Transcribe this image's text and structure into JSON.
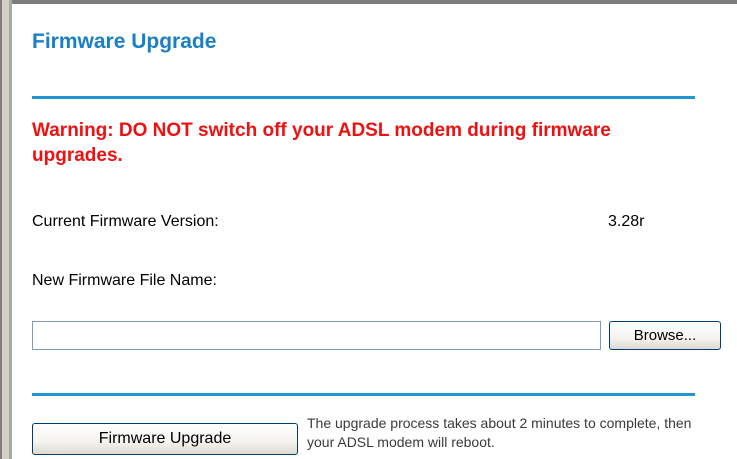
{
  "page": {
    "title": "Firmware Upgrade",
    "warning": "Warning: DO NOT switch off your ADSL modem during firmware upgrades."
  },
  "firmware": {
    "current_label": "Current Firmware Version:",
    "current_value": "3.28r",
    "new_file_label": "New Firmware File Name:",
    "file_value": "",
    "browse_label": "Browse..."
  },
  "upgrade": {
    "button_label": "Firmware Upgrade",
    "note": "The upgrade process takes about 2 minutes to complete, then your ADSL modem will reboot."
  },
  "colors": {
    "title": "#1b7fc4",
    "rule": "#2196d3",
    "warning": "#ee1111"
  }
}
